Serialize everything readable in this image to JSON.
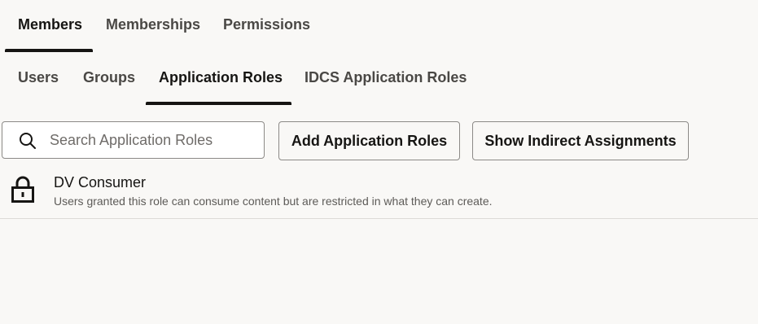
{
  "primary_tabs": {
    "members": "Members",
    "memberships": "Memberships",
    "permissions": "Permissions",
    "active": "Members"
  },
  "secondary_tabs": {
    "users": "Users",
    "groups": "Groups",
    "application_roles": "Application Roles",
    "idcs_application_roles": "IDCS Application Roles",
    "active": "Application Roles"
  },
  "toolbar": {
    "search_placeholder": "Search Application Roles",
    "search_value": "",
    "add_label": "Add Application Roles",
    "show_indirect_label": "Show Indirect Assignments"
  },
  "roles": [
    {
      "name": "DV Consumer",
      "description": "Users granted this role can consume content but are restricted in what they can create.",
      "icon": "lock-icon"
    }
  ],
  "colors": {
    "background": "#f9f8f6",
    "text": "#161513",
    "tab_inactive": "#4a4845",
    "border": "#8c8a87"
  }
}
